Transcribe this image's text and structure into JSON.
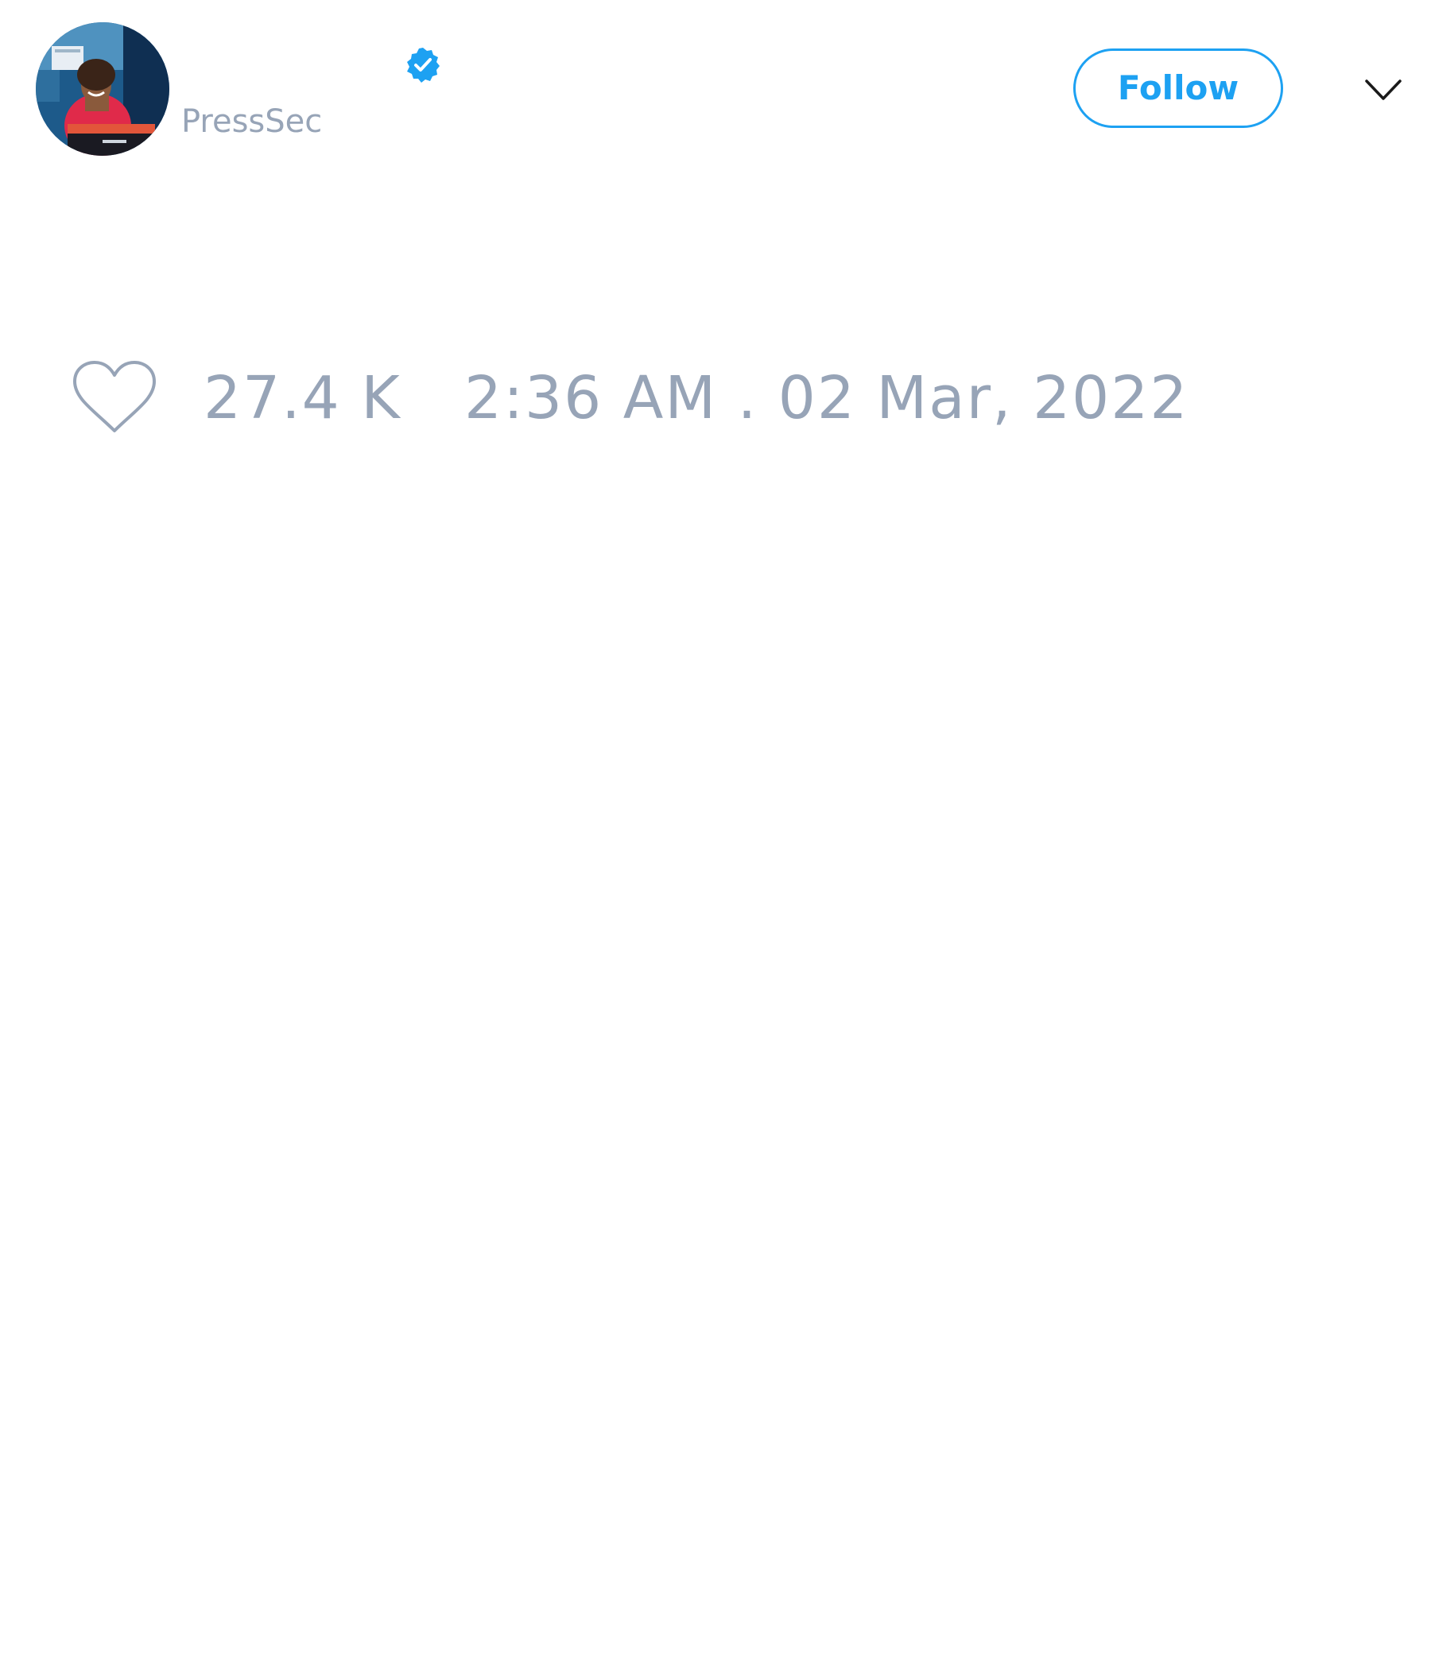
{
  "tweet": {
    "author": {
      "handle": "PressSec",
      "verified": true,
      "avatar": "press-secretary-at-podium-avatar"
    },
    "follow_label": "Follow",
    "menu_icon": "chevron-down-icon",
    "likes": {
      "icon": "heart-icon",
      "count": "27.4 K"
    },
    "timestamp": "2:36 AM . 02 Mar, 2022"
  },
  "colors": {
    "accent": "#1da1f2",
    "muted_text": "#97a4b7",
    "background": "#ffffff",
    "icon_dark": "#1a1a1a"
  }
}
